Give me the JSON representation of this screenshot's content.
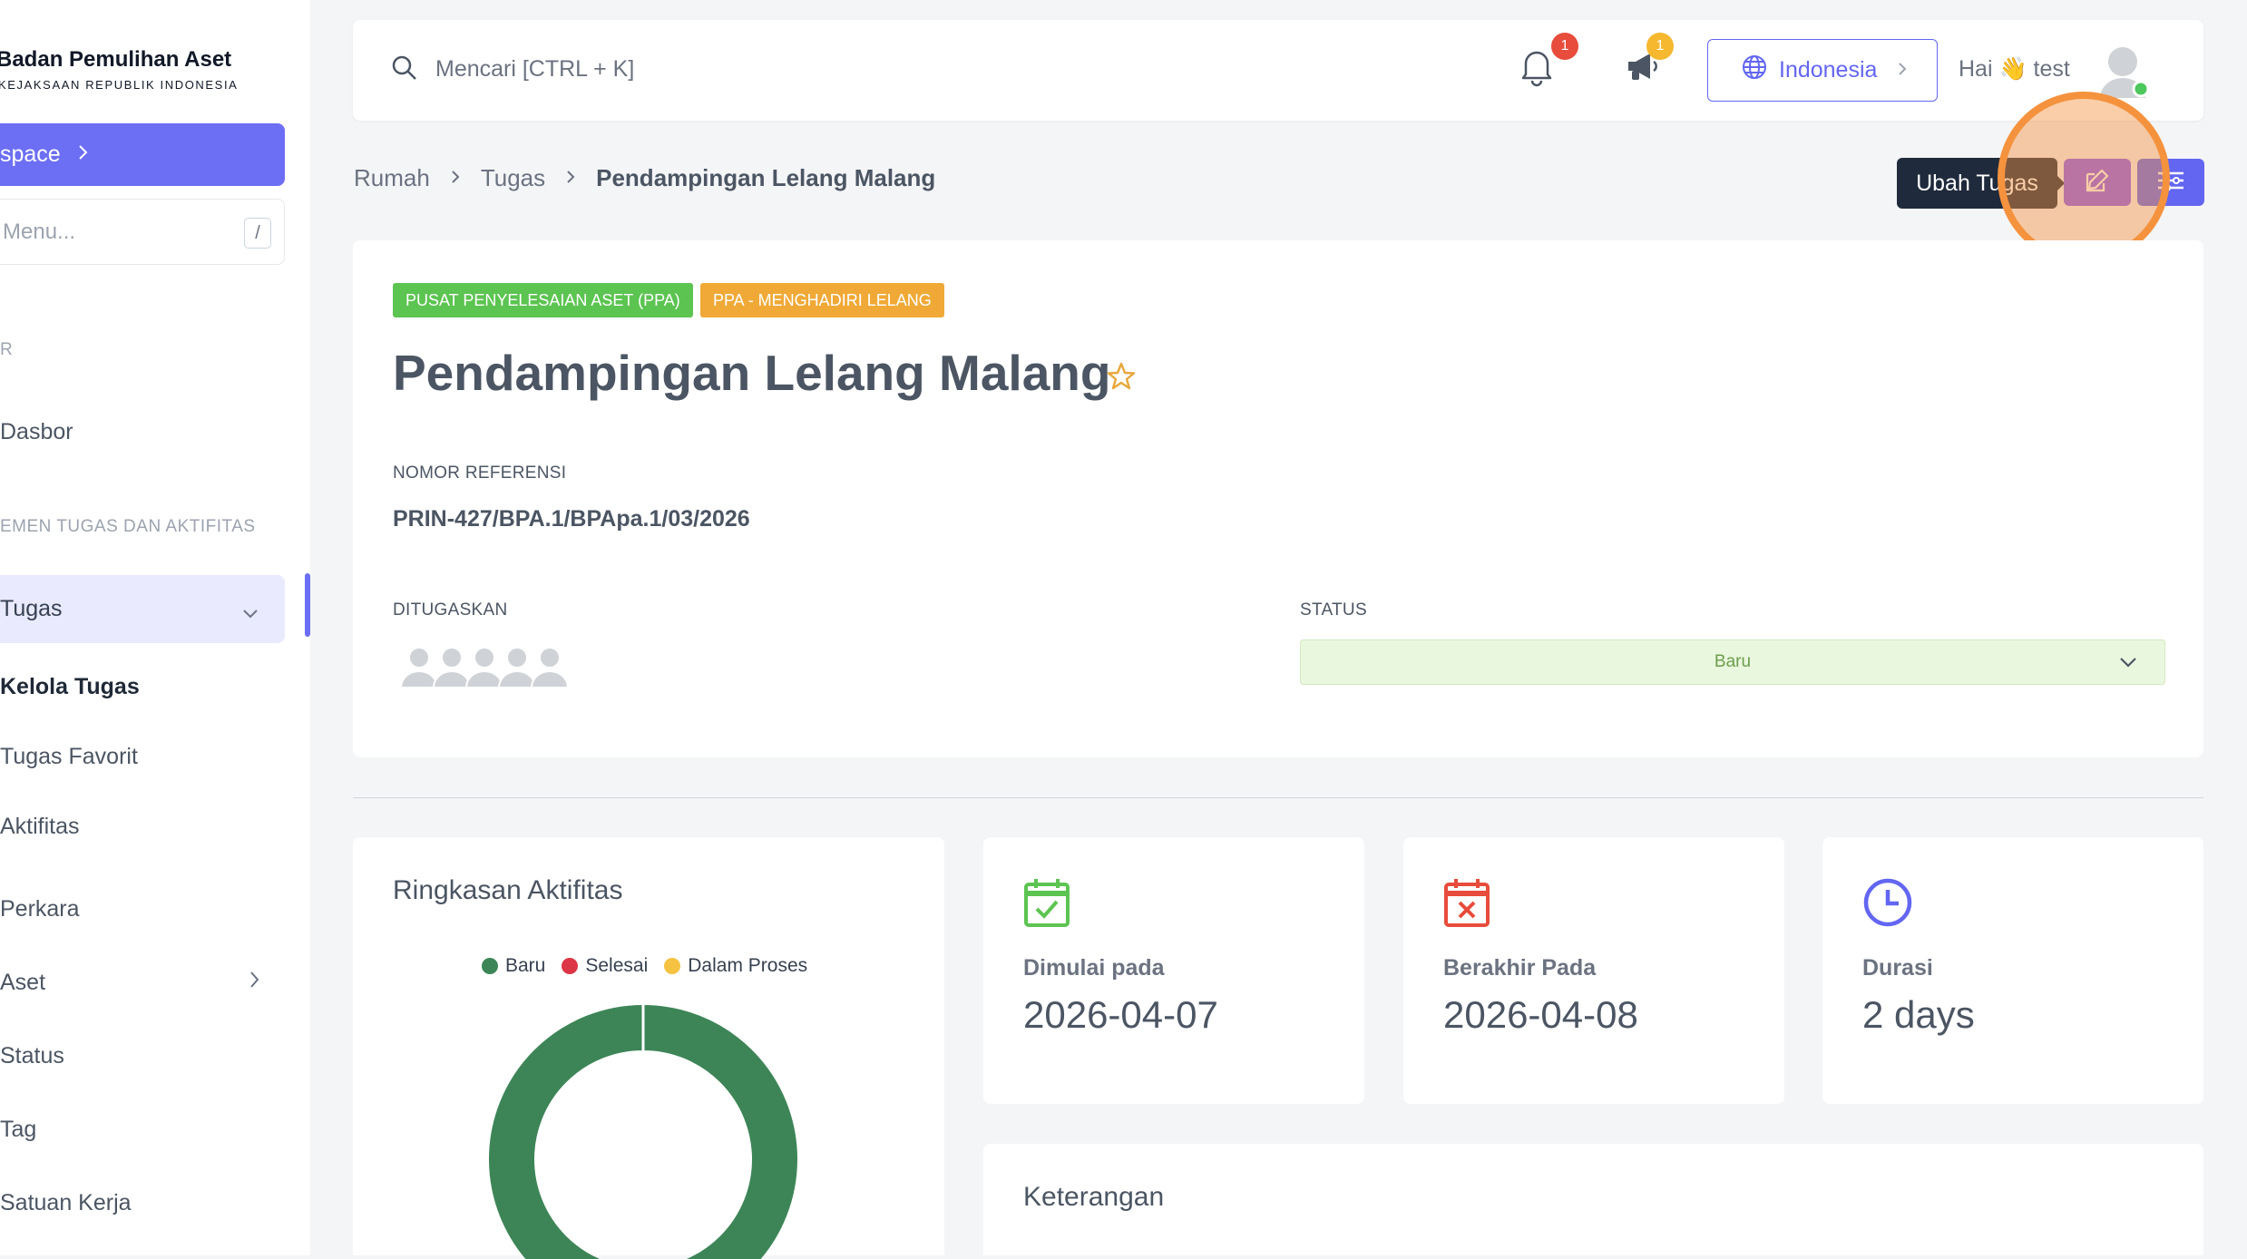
{
  "sidebar": {
    "brand_title": "Badan Pemulihan Aset",
    "brand_subtitle": "KEJAKSAAN REPUBLIK INDONESIA",
    "workspace_label": "space",
    "menu_search_placeholder": "Menu...",
    "menu_search_shortcut": "/",
    "section_1": "R",
    "dasbor": "Dasbor",
    "section_2": "EMEN TUGAS DAN AKTIFITAS",
    "tugas": "Tugas",
    "kelola_tugas": "Kelola Tugas",
    "tugas_favorit": "Tugas Favorit",
    "aktifitas": "Aktifitas",
    "perkara": "Perkara",
    "aset": "Aset",
    "status": "Status",
    "tag": "Tag",
    "satuan_kerja": "Satuan Kerja"
  },
  "topbar": {
    "search_placeholder": "Mencari [CTRL + K]",
    "notif_count": "1",
    "announce_count": "1",
    "language": "Indonesia",
    "greeting": "Hai 👋 test"
  },
  "breadcrumb": {
    "home": "Rumah",
    "tasks": "Tugas",
    "current": "Pendampingan Lelang Malang"
  },
  "actions": {
    "tooltip": "Ubah Tugas"
  },
  "task": {
    "tag_1": "PUSAT PENYELESAIAN ASET (PPA)",
    "tag_2": "PPA - MENGHADIRI LELANG",
    "title": "Pendampingan Lelang Malang",
    "ref_label": "NOMOR REFERENSI",
    "ref_value": "PRIN-427/BPA.1/BPApa.1/03/2026",
    "assigned_label": "DITUGASKAN",
    "status_label": "STATUS",
    "status_value": "Baru"
  },
  "summary": {
    "title": "Ringkasan Aktifitas",
    "legend": [
      "Baru",
      "Selesai",
      "Dalam Proses"
    ]
  },
  "chart_data": {
    "type": "pie",
    "title": "Ringkasan Aktifitas",
    "categories": [
      "Baru",
      "Selesai",
      "Dalam Proses"
    ],
    "values": [
      1,
      0,
      0
    ],
    "colors": [
      "#3d8557",
      "#dc3545",
      "#f5c242"
    ],
    "legend": "top"
  },
  "stats": {
    "start_label": "Dimulai pada",
    "start_value": "2026-04-07",
    "end_label": "Berakhir Pada",
    "end_value": "2026-04-08",
    "duration_label": "Durasi",
    "duration_value": "2 days"
  },
  "keterangan": {
    "title": "Keterangan"
  },
  "colors": {
    "primary": "#6c6ff3",
    "tag_green": "#5cc451",
    "tag_orange": "#f0a937",
    "highlight": "#f5923e"
  }
}
